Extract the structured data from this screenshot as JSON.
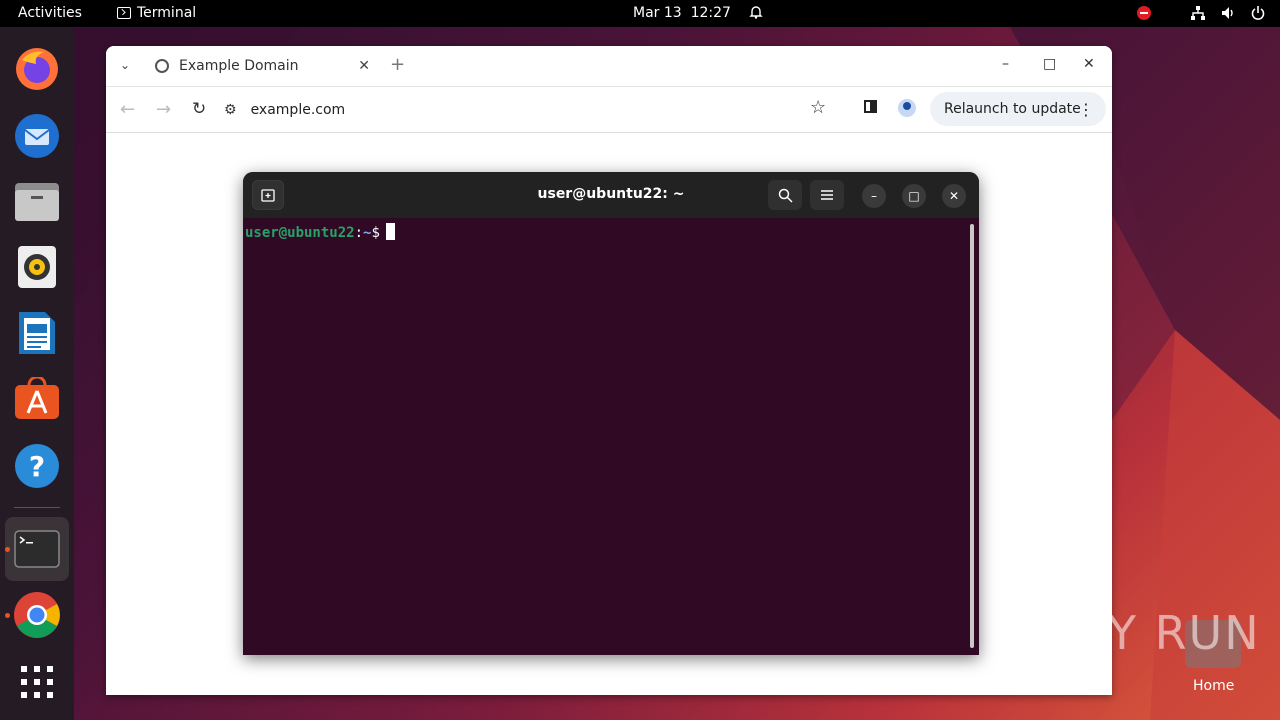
{
  "topbar": {
    "activities": "Activities",
    "app_name": "Terminal",
    "date": "Mar 13",
    "time": "12:27"
  },
  "dock": {
    "items": [
      "firefox-icon",
      "thunderbird-icon",
      "files-icon",
      "rhythmbox-icon",
      "libreoffice-writer-icon",
      "app-center-icon",
      "help-icon",
      "terminal-icon",
      "chrome-icon",
      "show-apps-icon"
    ]
  },
  "browser": {
    "tab_title": "Example Domain",
    "url": "example.com",
    "relaunch_label": "Relaunch to update"
  },
  "terminal": {
    "title": "user@ubuntu22: ~",
    "prompt_user": "user@ubuntu22",
    "prompt_colon": ":",
    "prompt_path": "~",
    "prompt_sign": "$"
  },
  "desktop": {
    "watermark": "ANY RUN",
    "home_label": "Home"
  },
  "colors": {
    "accent": "#e95420",
    "terminal_bg": "#300a24",
    "prompt_user": "#26a269"
  }
}
